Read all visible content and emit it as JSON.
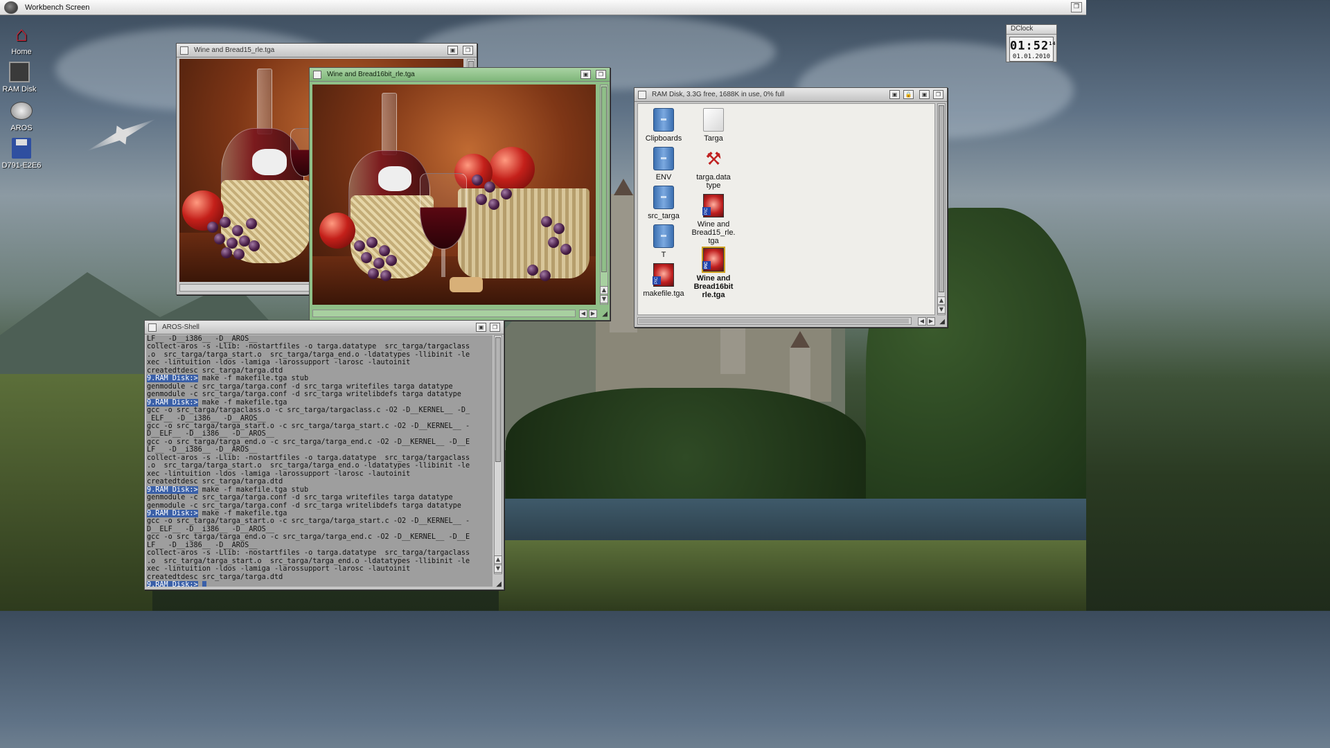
{
  "screen": {
    "title": "Workbench Screen"
  },
  "desktop_icons": [
    {
      "label": "Home"
    },
    {
      "label": "RAM Disk"
    },
    {
      "label": "AROS"
    },
    {
      "label": "D791-E2E6"
    }
  ],
  "clock": {
    "title": "DClock",
    "time": "01:52",
    "seconds": "14",
    "date": "01.01.2010"
  },
  "windows": {
    "img15": {
      "title": "Wine and Bread15_rle.tga"
    },
    "img16": {
      "title": "Wine and Bread16bit_rle.tga"
    },
    "ramdisk": {
      "title": "RAM Disk, 3.3G free, 1688K in use, 0% full",
      "icons": [
        {
          "label": "Clipboards",
          "type": "drawer"
        },
        {
          "label": "Targa",
          "type": "document"
        },
        {
          "label": "ENV",
          "type": "drawer"
        },
        {
          "label": "targa.data\ntype",
          "type": "tool"
        },
        {
          "label": "src_targa",
          "type": "drawer"
        },
        {
          "label": "Wine and\nBread15_rle.\ntga",
          "type": "picture"
        },
        {
          "label": "T",
          "type": "drawer"
        },
        {
          "label": "Wine and\nBread16bit\nrle.tga",
          "type": "picture-selected"
        },
        {
          "label": "makefile.tga",
          "type": "picture"
        }
      ]
    },
    "shell": {
      "title": "AROS-Shell",
      "lines": [
        {
          "text": "LF__ -D__i386__ -D__AROS__"
        },
        {
          "text": "collect-aros -s -Llib: -nostartfiles -o targa.datatype  src_targa/targaclass"
        },
        {
          "text": ".o  src_targa/targa_start.o  src_targa/targa_end.o -ldatatypes -llibinit -le"
        },
        {
          "text": "xec -lintuition -ldos -lamiga -larossupport -larosc -lautoinit"
        },
        {
          "text": "createdtdesc src_targa/targa.dtd"
        },
        {
          "prompt": "9.RAM Disk:>",
          "text": " make -f makefile.tga stub"
        },
        {
          "text": "genmodule -c src_targa/targa.conf -d src_targa writefiles targa datatype"
        },
        {
          "text": "genmodule -c src_targa/targa.conf -d src_targa writelibdefs targa datatype"
        },
        {
          "prompt": "9.RAM Disk:>",
          "text": " make -f makefile.tga"
        },
        {
          "text": "gcc -o src_targa/targaclass.o -c src_targa/targaclass.c -O2 -D__KERNEL__ -D_"
        },
        {
          "text": "_ELF__ -D__i386__ -D__AROS__"
        },
        {
          "text": "gcc -o src_targa/targa_start.o -c src_targa/targa_start.c -O2 -D__KERNEL__ -"
        },
        {
          "text": "D__ELF__ -D__i386__ -D__AROS__"
        },
        {
          "text": "gcc -o src_targa/targa_end.o -c src_targa/targa_end.c -O2 -D__KERNEL__ -D__E"
        },
        {
          "text": "LF__ -D__i386__ -D__AROS__"
        },
        {
          "text": "collect-aros -s -Llib: -nostartfiles -o targa.datatype  src_targa/targaclass"
        },
        {
          "text": ".o  src_targa/targa_start.o  src_targa/targa_end.o -ldatatypes -llibinit -le"
        },
        {
          "text": "xec -lintuition -ldos -lamiga -larossupport -larosc -lautoinit"
        },
        {
          "text": "createdtdesc src_targa/targa.dtd"
        },
        {
          "prompt": "9.RAM Disk:>",
          "text": " make -f makefile.tga stub"
        },
        {
          "text": "genmodule -c src_targa/targa.conf -d src_targa writefiles targa datatype"
        },
        {
          "text": "genmodule -c src_targa/targa.conf -d src_targa writelibdefs targa datatype"
        },
        {
          "prompt": "9.RAM Disk:>",
          "text": " make -f makefile.tga"
        },
        {
          "text": "gcc -o src_targa/targa_start.o -c src_targa/targa_start.c -O2 -D__KERNEL__ -"
        },
        {
          "text": "D__ELF__ -D__i386__ -D__AROS__"
        },
        {
          "text": "gcc -o src_targa/targa_end.o -c src_targa/targa_end.c -O2 -D__KERNEL__ -D__E"
        },
        {
          "text": "LF__ -D__i386__ -D__AROS__"
        },
        {
          "text": "collect-aros -s -Llib: -nostartfiles -o targa.datatype  src_targa/targaclass"
        },
        {
          "text": ".o  src_targa/targa_start.o  src_targa/targa_end.o -ldatatypes -llibinit -le"
        },
        {
          "text": "xec -lintuition -ldos -lamiga -larossupport -larosc -lautoinit"
        },
        {
          "text": "createdtdesc src_targa/targa.dtd"
        },
        {
          "prompt": "9.RAM Disk:>",
          "text": " "
        }
      ]
    }
  },
  "colors": {
    "active_titlebar": "#8fbf88",
    "prompt_highlight": "#3a60a8",
    "shell_background": "#9e9e9e"
  }
}
